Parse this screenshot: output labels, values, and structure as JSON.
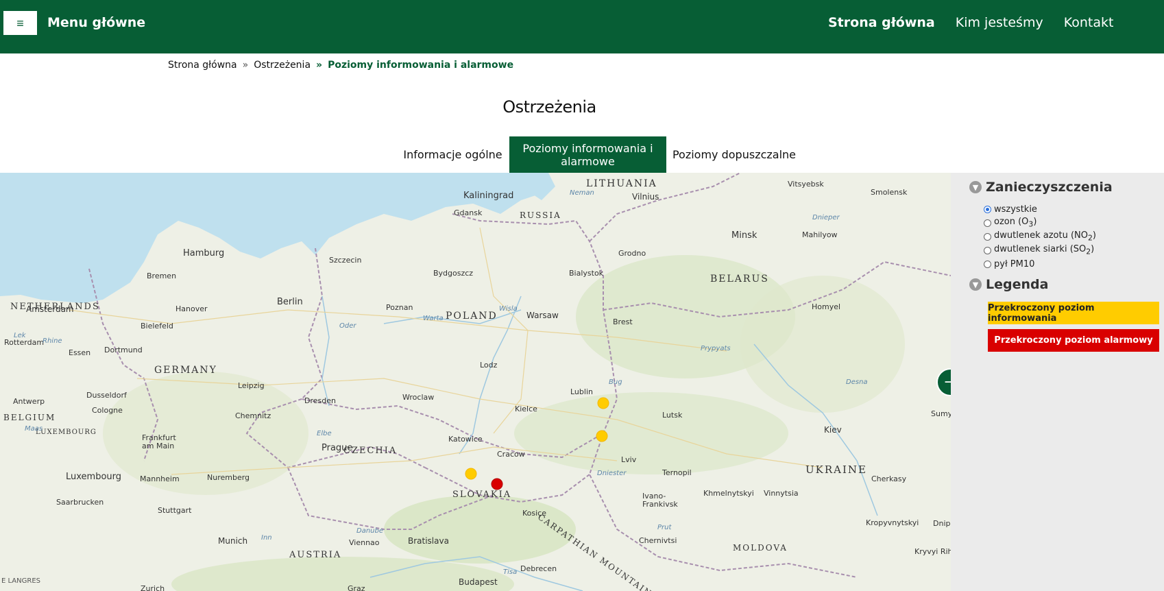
{
  "header": {
    "menu_icon": "hamburger-icon",
    "menu_title": "Menu główne",
    "nav": [
      "Strona główna",
      "Kim jesteśmy",
      "Kontakt"
    ],
    "brand_color": "#075e35"
  },
  "breadcrumb": {
    "items": [
      "Strona główna",
      "Ostrzeżenia"
    ],
    "current": "Poziomy informowania i alarmowe",
    "separator": "»"
  },
  "page_title": "Ostrzeżenia",
  "tabs": {
    "items": [
      "Informacje ogólne",
      "Poziomy informowania i alarmowe",
      "Poziomy dopuszczalne"
    ],
    "active_index": 1
  },
  "map": {
    "copyright": "E LANGRES",
    "country_labels": [
      "LITHUANIA",
      "RUSSIA",
      "NETHERLANDS",
      "POLAND",
      "BELARUS",
      "GERMANY",
      "BELGIUM",
      "CZECHIA",
      "SLOVAKIA",
      "UKRAINE",
      "AUSTRIA",
      "MOLDOVA",
      "LUXEMBOURG",
      "CARPATHIAN MOUNTAINS"
    ],
    "city_labels": [
      "Kaliningrad",
      "Vilnius",
      "Vitsyebsk",
      "Smolensk",
      "Gdansk",
      "Hamburg",
      "Szczecin",
      "Bydgoszcz",
      "Bialystok",
      "Grodno",
      "Minsk",
      "Mahilyow",
      "Bremen",
      "Berlin",
      "Hanover",
      "Poznan",
      "Warsaw",
      "Brest",
      "Homyel",
      "Amsterdam",
      "Bielefeld",
      "Rotterdam",
      "Essen",
      "Dortmund",
      "Lodz",
      "Lublin",
      "Leipzig",
      "Dusseldorf",
      "Dresden",
      "Wroclaw",
      "Kielce",
      "Antwerp",
      "Cologne",
      "Chemnitz",
      "Lutsk",
      "Sumy",
      "Kiev",
      "Frankfurt am Main",
      "Prague",
      "Katowice",
      "Cracow",
      "Lviv",
      "Luxembourg",
      "Mannheim",
      "Nuremberg",
      "Ternopil",
      "Cherkasy",
      "Saarbrucken",
      "Khmelnytskyi",
      "Vinnytsia",
      "Ivano-Frankivsk",
      "Kosice",
      "Stuttgart",
      "Kropyvnytskyi",
      "Munich",
      "Viennao",
      "Bratislava",
      "Chernivtsi",
      "Kryvyi Rih",
      "Debrecen",
      "Budapest",
      "Zurich",
      "Graz",
      "Dnip"
    ],
    "river_labels": [
      "Neman",
      "Oder",
      "Warta",
      "Wisla",
      "Elbe",
      "Danube",
      "Inn",
      "Prypyats",
      "Desna",
      "Dniester",
      "Prut",
      "Bug",
      "Dnieper",
      "Tisa",
      "Rhine",
      "Maas",
      "Lek"
    ],
    "markers": [
      {
        "level": "informowania",
        "color": "#ffcc00"
      },
      {
        "level": "informowania",
        "color": "#ffcc00"
      },
      {
        "level": "informowania",
        "color": "#ffcc00"
      },
      {
        "level": "alarmowy",
        "color": "#d90000"
      }
    ],
    "next_button_icon": "arrow-right-icon"
  },
  "sidebar": {
    "pollutants_title": "Zanieczyszczenia",
    "pollutants": [
      {
        "pre": "wszystkie",
        "sub": "",
        "post": "",
        "selected": true
      },
      {
        "pre": "ozon (O",
        "sub": "3",
        "post": ")",
        "selected": false
      },
      {
        "pre": "dwutlenek azotu (NO",
        "sub": "2",
        "post": ")",
        "selected": false
      },
      {
        "pre": "dwutlenek siarki (SO",
        "sub": "2",
        "post": ")",
        "selected": false
      },
      {
        "pre": "pył PM10",
        "sub": "",
        "post": "",
        "selected": false
      }
    ],
    "legend_title": "Legenda",
    "legend": [
      {
        "label": "Przekroczony poziom informowania",
        "color": "#ffcc00"
      },
      {
        "label": "Przekroczony poziom alarmowy",
        "color": "#d90000"
      }
    ],
    "collapse_icon": "chevron-down-icon"
  }
}
